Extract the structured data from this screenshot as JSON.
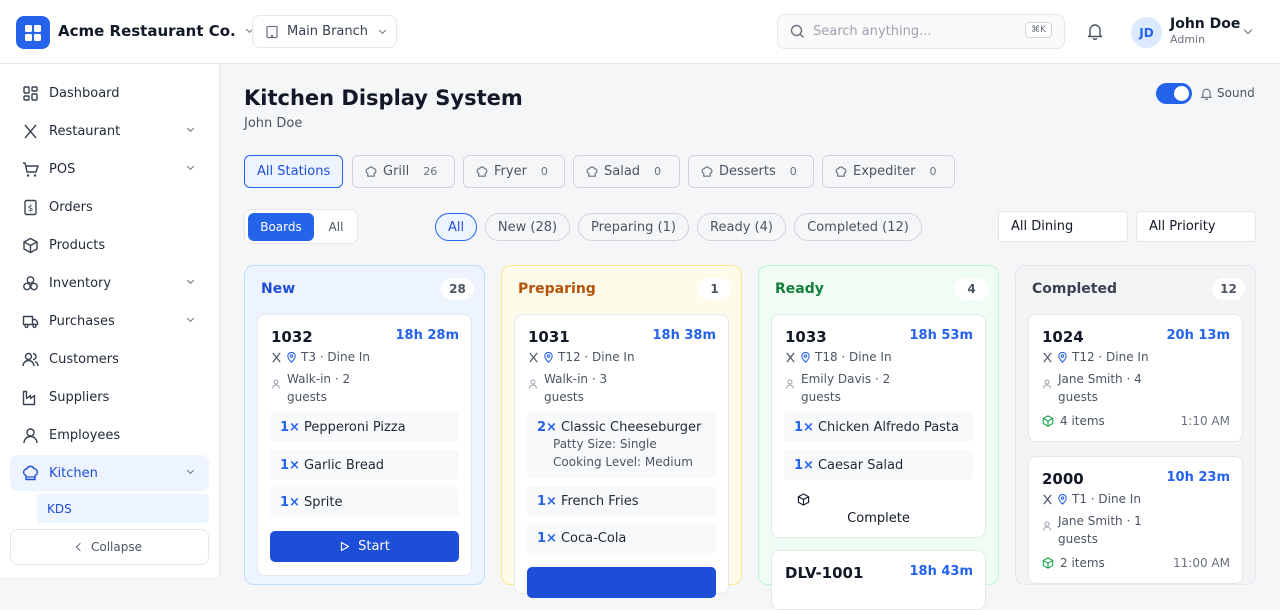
{
  "header": {
    "company": "Acme Restaurant Co.",
    "branch": "Main Branch",
    "search_placeholder": "Search anything...",
    "search_shortcut": "⌘K",
    "user_initials": "JD",
    "user_name": "John Doe",
    "user_role": "Admin"
  },
  "sidebar": {
    "items": [
      {
        "label": "Dashboard",
        "icon": "grid-icon",
        "expandable": false
      },
      {
        "label": "Restaurant",
        "icon": "utensils-icon",
        "expandable": true
      },
      {
        "label": "POS",
        "icon": "cart-icon",
        "expandable": true
      },
      {
        "label": "Orders",
        "icon": "receipt-icon",
        "expandable": false
      },
      {
        "label": "Products",
        "icon": "box-icon",
        "expandable": false
      },
      {
        "label": "Inventory",
        "icon": "boxes-icon",
        "expandable": true
      },
      {
        "label": "Purchases",
        "icon": "truck-icon",
        "expandable": true
      },
      {
        "label": "Customers",
        "icon": "users-icon",
        "expandable": false
      },
      {
        "label": "Suppliers",
        "icon": "factory-icon",
        "expandable": false
      },
      {
        "label": "Employees",
        "icon": "user-icon",
        "expandable": false
      },
      {
        "label": "Kitchen",
        "icon": "chef-hat-icon",
        "expandable": true,
        "active": true
      }
    ],
    "subitem": "KDS",
    "collapse": "Collapse"
  },
  "page": {
    "title": "Kitchen Display System",
    "subtitle": "John Doe",
    "sound_label": "Sound",
    "sound_on": true
  },
  "stations": [
    {
      "label": "All Stations",
      "count": ""
    },
    {
      "label": "Grill",
      "count": "26"
    },
    {
      "label": "Fryer",
      "count": "0"
    },
    {
      "label": "Salad",
      "count": "0"
    },
    {
      "label": "Desserts",
      "count": "0"
    },
    {
      "label": "Expediter",
      "count": "0"
    }
  ],
  "view": {
    "boards": "Boards",
    "all": "All"
  },
  "filters": [
    "All",
    "New (28)",
    "Preparing (1)",
    "Ready (4)",
    "Completed (12)"
  ],
  "selects": {
    "dining": "All Dining",
    "priority": "All Priority"
  },
  "columns": {
    "new": {
      "title": "New",
      "count": "28",
      "card": {
        "id": "1032",
        "time": "18h 28m",
        "meta": "T3 · Dine In",
        "customer": "Walk-in · 2 guests",
        "items": [
          {
            "qty": "1×",
            "name": "Pepperoni Pizza"
          },
          {
            "qty": "1×",
            "name": "Garlic Bread"
          },
          {
            "qty": "1×",
            "name": "Sprite"
          }
        ],
        "action": "Start"
      }
    },
    "preparing": {
      "title": "Preparing",
      "count": "1",
      "card": {
        "id": "1031",
        "time": "18h 38m",
        "meta": "T12 · Dine In",
        "customer": "Walk-in · 3 guests",
        "items": [
          {
            "qty": "2×",
            "name": "Classic Cheeseburger",
            "mods": [
              "Patty Size: Single",
              "Cooking Level: Medium"
            ]
          },
          {
            "qty": "1×",
            "name": "French Fries"
          },
          {
            "qty": "1×",
            "name": "Coca-Cola"
          }
        ]
      }
    },
    "ready": {
      "title": "Ready",
      "count": "4",
      "card": {
        "id": "1033",
        "time": "18h 53m",
        "meta": "T18 · Dine In",
        "customer": "Emily Davis · 2 guests",
        "items": [
          {
            "qty": "1×",
            "name": "Chicken Alfredo Pasta"
          },
          {
            "qty": "1×",
            "name": "Caesar Salad"
          }
        ],
        "action": "Complete"
      },
      "card2": {
        "id": "DLV-1001",
        "time": "18h 43m"
      }
    },
    "completed": {
      "title": "Completed",
      "count": "12",
      "cards": [
        {
          "id": "1024",
          "time": "20h 13m",
          "meta": "T12 · Dine In",
          "customer": "Jane Smith · 4 guests",
          "items": "4 items",
          "done": "1:10 AM"
        },
        {
          "id": "2000",
          "time": "10h 23m",
          "meta": "T1 · Dine In",
          "customer": "Jane Smith · 1 guests",
          "items": "2 items",
          "done": "11:00 AM"
        }
      ]
    }
  },
  "colors": {
    "accent": "#2563eb",
    "new_bg": "#eef4ff",
    "new_border": "#bfdbfe",
    "new_title": "#1d4ed8",
    "preparing_bg": "#fffbeb",
    "preparing_border": "#fde68a",
    "preparing_title": "#b45309",
    "ready_bg": "#f0fdf4",
    "ready_border": "#bbf7d0",
    "ready_title": "#15803d",
    "completed_bg": "#f3f4f6",
    "completed_border": "#e5e7eb",
    "completed_title": "#374151"
  }
}
